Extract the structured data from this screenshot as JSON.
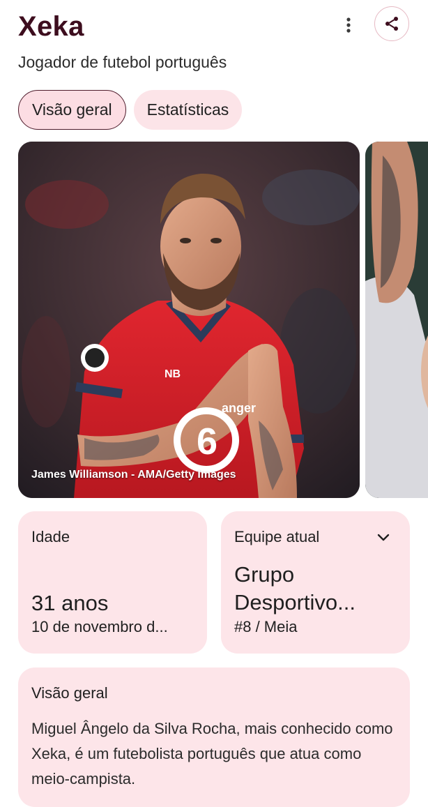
{
  "header": {
    "title": "Xeka",
    "subtitle": "Jogador de futebol português",
    "more_icon": "more-vert-icon",
    "share_icon": "share-icon",
    "accent_color": "#3d0d1e"
  },
  "tabs": [
    {
      "label": "Visão geral",
      "active": true
    },
    {
      "label": "Estatísticas",
      "active": false
    }
  ],
  "gallery": {
    "main_photo_credit": "James Williamson - AMA/Getty Images",
    "jersey_sponsor": "anger",
    "jersey_number": "6"
  },
  "cards": {
    "age": {
      "label": "Idade",
      "value": "31 anos",
      "detail": "10 de novembro d..."
    },
    "team": {
      "label": "Equipe atual",
      "value_line1": "Grupo",
      "value_line2": "Desportivo...",
      "detail": "#8 / Meia",
      "expand_icon": "chevron-down-icon"
    }
  },
  "overview": {
    "title": "Visão geral",
    "text": "Miguel Ângelo da Silva Rocha, mais conhecido como Xeka, é um futebolista português que atua como meio-campista."
  },
  "colors": {
    "card_bg": "#fde5e9",
    "tab_bg": "#fce4e8",
    "tab_active_border": "#4e1b2b",
    "jersey_red": "#d8232c"
  }
}
